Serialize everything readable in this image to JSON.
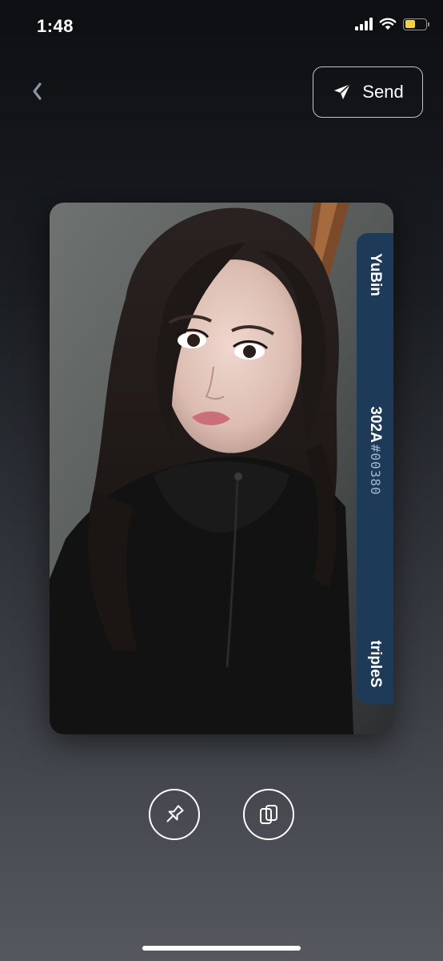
{
  "status_bar": {
    "time": "1:48",
    "battery_color": "#f2d33a"
  },
  "header": {
    "back_icon": "chevron-left-icon",
    "send_label": "Send",
    "send_icon": "paper-plane-icon"
  },
  "card": {
    "member": "YuBin",
    "collection": "302A",
    "serial": "#00380",
    "artist": "tripleS",
    "panel_color": "#1d3b58",
    "photo_description_icon": "photo-image"
  },
  "actions": {
    "pin_icon": "pin-icon",
    "copy_icon": "copy-icon"
  }
}
